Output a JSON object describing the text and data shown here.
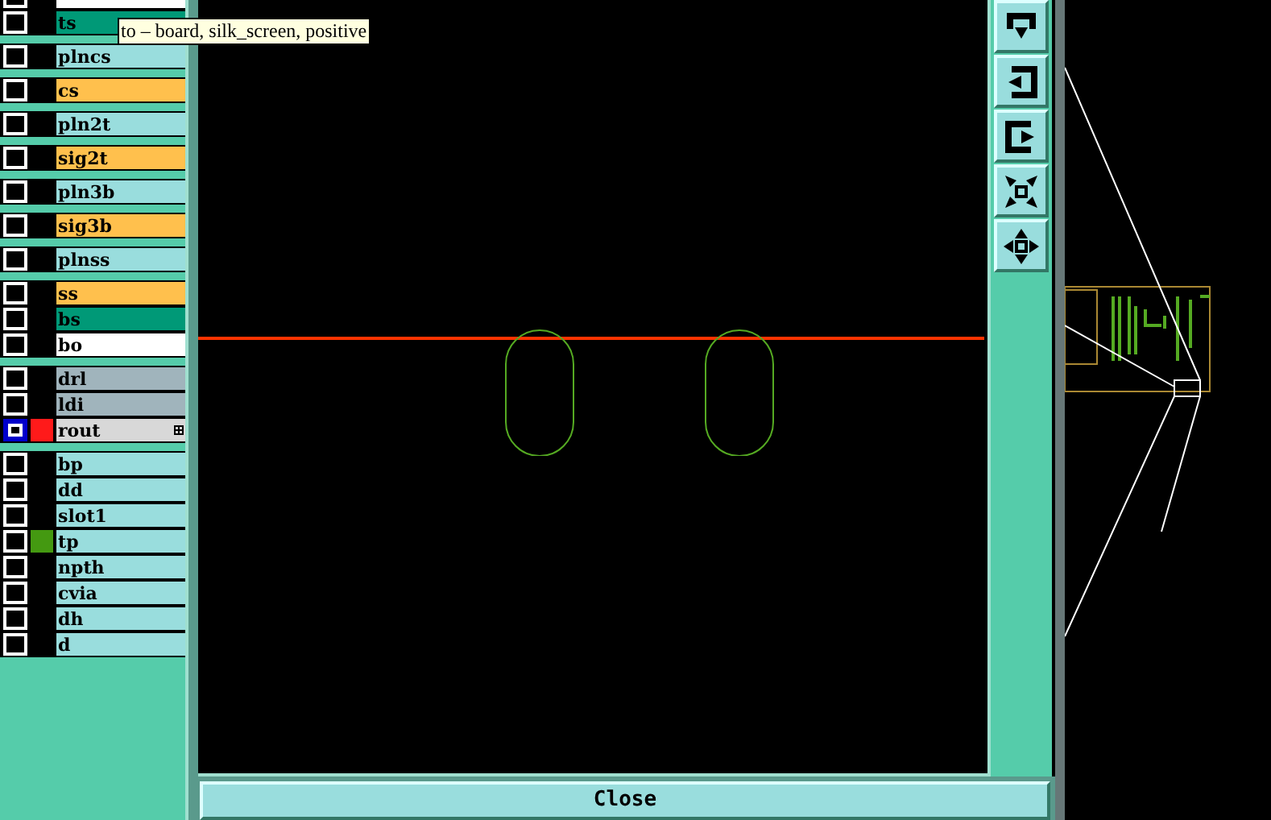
{
  "layers": [
    [
      {
        "color": "#ffffff",
        "selected": false
      },
      {
        "name": "ts",
        "color": "#009977",
        "selected": false
      }
    ],
    [
      {
        "name": "plncs",
        "color": "#99dddd",
        "selected": false
      }
    ],
    [
      {
        "name": "cs",
        "color": "#ffc04d",
        "selected": false
      }
    ],
    [
      {
        "name": "pln2t",
        "color": "#99dddd",
        "selected": false
      }
    ],
    [
      {
        "name": "sig2t",
        "color": "#ffc04d",
        "selected": false
      }
    ],
    [
      {
        "name": "pln3b",
        "color": "#99dddd",
        "selected": false
      }
    ],
    [
      {
        "name": "sig3b",
        "color": "#ffc04d",
        "selected": false
      }
    ],
    [
      {
        "name": "plnss",
        "color": "#99dddd",
        "selected": false
      }
    ],
    [
      {
        "name": "ss",
        "color": "#ffc04d",
        "selected": false
      },
      {
        "name": "bs",
        "color": "#009977",
        "selected": false
      },
      {
        "name": "bo",
        "color": "#ffffff",
        "selected": false
      }
    ],
    [
      {
        "name": "drl",
        "color": "#a0b4bc",
        "selected": false
      },
      {
        "name": "ldi",
        "color": "#a0b4bc",
        "selected": false
      },
      {
        "name": "rout",
        "color": "#d8d8d8",
        "swatch": {
          "color": "#ff1a1a"
        },
        "selected": true
      }
    ],
    [
      {
        "name": "bp",
        "color": "#99dddd",
        "selected": false
      },
      {
        "name": "dd",
        "color": "#99dddd",
        "selected": false
      },
      {
        "name": "slot1",
        "color": "#99dddd",
        "selected": false
      },
      {
        "name": "tp",
        "color": "#99dddd",
        "swatch": {
          "color": "#449911"
        },
        "selected": false
      },
      {
        "name": "npth",
        "color": "#99dddd",
        "selected": false
      },
      {
        "name": "cvia",
        "color": "#99dddd",
        "selected": false
      },
      {
        "name": "dh",
        "color": "#99dddd",
        "selected": false
      },
      {
        "name": "d",
        "color": "#99dddd",
        "selected": false
      }
    ]
  ],
  "tooltip": "to – board, silk_screen, positive",
  "close_button": "Close"
}
